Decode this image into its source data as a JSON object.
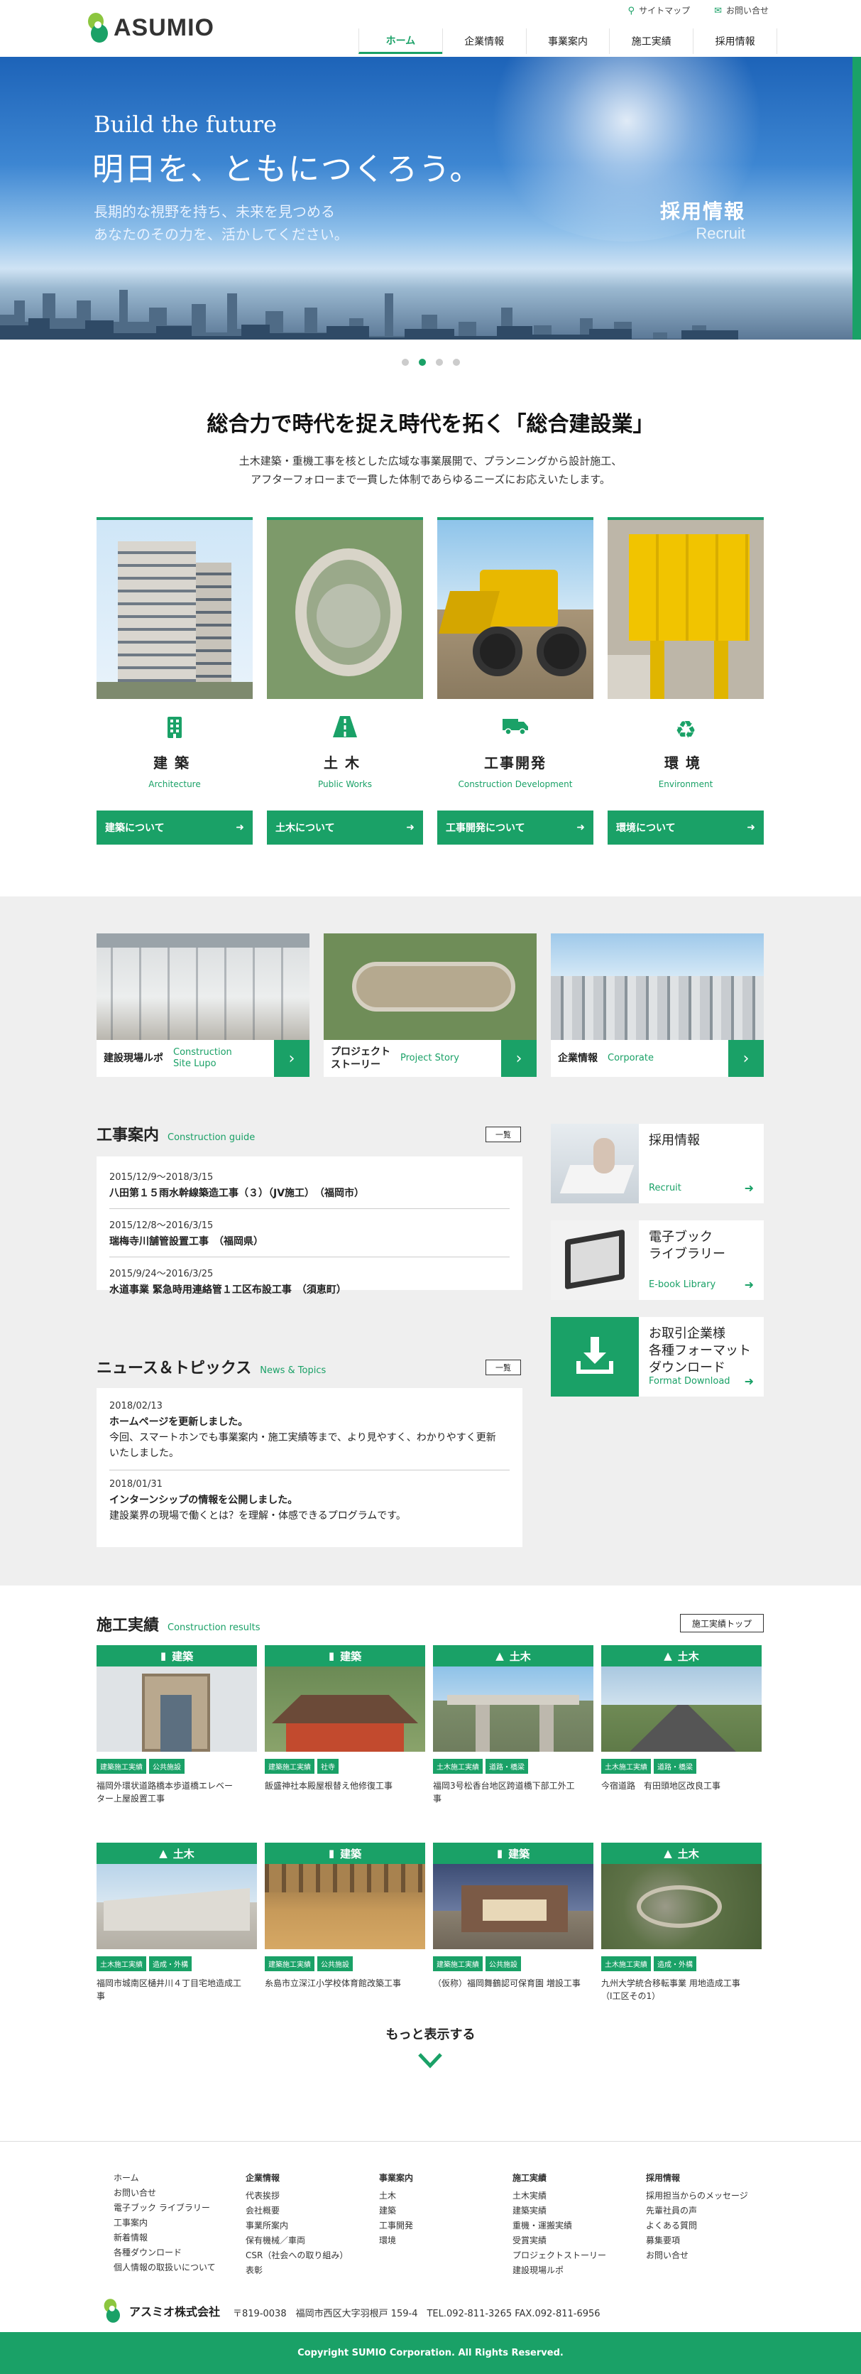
{
  "header": {
    "logo": "ASUMIO",
    "util": [
      {
        "icon": "sitemap-icon",
        "label": "サイトマップ"
      },
      {
        "icon": "mail-icon",
        "label": "お問い合せ"
      }
    ],
    "nav": [
      "ホーム",
      "企業情報",
      "事業案内",
      "施工実績",
      "採用情報"
    ]
  },
  "hero": {
    "en": "Build the future",
    "ja": "明日を、ともにつくろう。",
    "sub1": "長期的な視野を持ち、未来を見つめる",
    "sub2": "あなたのその力を、活かしてください。",
    "recruit_ja": "採用情報",
    "recruit_en": "Recruit"
  },
  "intro": {
    "title": "総合力で時代を捉え時代を拓く「総合建設業」",
    "text1": "土木建築・重機工事を核とした広域な事業展開で、プランニングから設計施工、",
    "text2": "アフターフォローまで一貫した体制であらゆるニーズにお応えいたします。"
  },
  "business": [
    {
      "ja": "建築",
      "en": "Architecture",
      "btn": "建築について",
      "icon": "building-icon"
    },
    {
      "ja": "土木",
      "en": "Public Works",
      "btn": "土木について",
      "icon": "road-icon"
    },
    {
      "ja": "工事開発",
      "en": "Construction Development",
      "btn": "工事開発について",
      "icon": "truck-icon"
    },
    {
      "ja": "環境",
      "en": "Environment",
      "btn": "環境について",
      "icon": "recycle-icon"
    }
  ],
  "cards": [
    {
      "ja": "建設現場ルポ",
      "en1": "Construction",
      "en2": "Site Lupo"
    },
    {
      "ja1": "プロジェクト",
      "ja2": "ストーリー",
      "en": "Project Story"
    },
    {
      "ja": "企業情報",
      "en": "Corporate"
    }
  ],
  "guide": {
    "title": "工事案内",
    "en": "Construction guide",
    "list_btn": "一覧",
    "items": [
      {
        "date": "2015/12/9～2018/3/15",
        "title": "八田第１５雨水幹線築造工事（３）（JV施工）　（福岡市）"
      },
      {
        "date": "2015/12/8～2016/3/15",
        "title": "瑞梅寺川舗管設置工事　（福岡県）"
      },
      {
        "date": "2015/9/24～2016/3/25",
        "title": "水道事業 緊急時用連絡管１工区布設工事　（須恵町）"
      }
    ]
  },
  "news": {
    "title": "ニュース＆トピックス",
    "en": "News & Topics",
    "list_btn": "一覧",
    "items": [
      {
        "date": "2018/02/13",
        "title": "ホームページを更新しました。",
        "body1": "今回、スマートホンでも事業案内・施工実績等まで、より見やすく、わかりやすく更新",
        "body2": "いたしました。"
      },
      {
        "date": "2018/01/31",
        "title": "インターンシップの情報を公開しました。",
        "body1": "建設業界の現場で働くとは？を理解・体感できるプログラムです。",
        "body2": ""
      }
    ]
  },
  "side": [
    {
      "ja1": "採用情報",
      "ja2": "",
      "ja3": "",
      "en": "Recruit"
    },
    {
      "ja1": "電子ブック",
      "ja2": "ライブラリー",
      "ja3": "",
      "en": "E-book Library"
    },
    {
      "ja1": "お取引企業様",
      "ja2": "各種フォーマット",
      "ja3": "ダウンロード",
      "en": "Format Download"
    }
  ],
  "works": {
    "title": "施工実績",
    "en": "Construction results",
    "top_btn": "施工実績トップ",
    "items": [
      {
        "cat": "建築",
        "icon": "building-icon",
        "tags": [
          "建築施工実績",
          "公共施設"
        ],
        "name1": "福岡外環状道路橋本歩道橋エレベー",
        "name2": "ター上屋設置工事"
      },
      {
        "cat": "建築",
        "icon": "building-icon",
        "tags": [
          "建築施工実績",
          "社寺"
        ],
        "name1": "飯盛神社本殿屋根替え他修復工事",
        "name2": ""
      },
      {
        "cat": "土木",
        "icon": "road-icon",
        "tags": [
          "土木施工実績",
          "道路・橋梁"
        ],
        "name1": "福岡3号松香台地区跨道橋下部工外工",
        "name2": "事"
      },
      {
        "cat": "土木",
        "icon": "road-icon",
        "tags": [
          "土木施工実績",
          "道路・橋梁"
        ],
        "name1": "今宿道路　有田頭地区改良工事",
        "name2": ""
      },
      {
        "cat": "土木",
        "icon": "road-icon",
        "tags": [
          "土木施工実績",
          "造成・外構"
        ],
        "name1": "福岡市城南区樋井川４丁目宅地造成工",
        "name2": "事"
      },
      {
        "cat": "建築",
        "icon": "building-icon",
        "tags": [
          "建築施工実績",
          "公共施設"
        ],
        "name1": "糸島市立深江小学校体育館改築工事",
        "name2": ""
      },
      {
        "cat": "建築",
        "icon": "building-icon",
        "tags": [
          "建築施工実績",
          "公共施設"
        ],
        "name1": "（仮称）福岡舞鶴認可保育園 増設工事",
        "name2": ""
      },
      {
        "cat": "土木",
        "icon": "road-icon",
        "tags": [
          "土木施工実績",
          "造成・外構"
        ],
        "name1": "九州大学統合移転事業 用地造成工事",
        "name2": "（I工区その1）"
      }
    ],
    "more": "もっと表示する"
  },
  "footer": {
    "col1": [
      "ホーム",
      "お問い合せ",
      "電子ブック ライブラリー",
      "工事案内",
      "新着情報",
      "各種ダウンロード",
      "個人情報の取扱いについて"
    ],
    "col2": {
      "h": "企業情報",
      "items": [
        "代表挨拶",
        "会社概要",
        "事業所案内",
        "保有機械／車両",
        "CSR（社会への取り組み）",
        "表彰"
      ]
    },
    "col3": {
      "h": "事業案内",
      "items": [
        "土木",
        "建築",
        "工事開発",
        "環境"
      ]
    },
    "col4": {
      "h": "施工実績",
      "items": [
        "土木実績",
        "建築実績",
        "重機・運搬実績",
        "受賞実績",
        "プロジェクトストーリー",
        "建設現場ルポ"
      ]
    },
    "col5": {
      "h": "採用情報",
      "items": [
        "採用担当からのメッセージ",
        "先輩社員の声",
        "よくある質問",
        "募集要項",
        "お問い合せ"
      ]
    },
    "company": "アスミオ株式会社",
    "address": "〒819-0038　福岡市西区大字羽根戸 159-4　TEL.092-811-3265 FAX.092-811-6956",
    "copyright": "Copyright SUMIO Corporation. All Rights Reserved."
  }
}
